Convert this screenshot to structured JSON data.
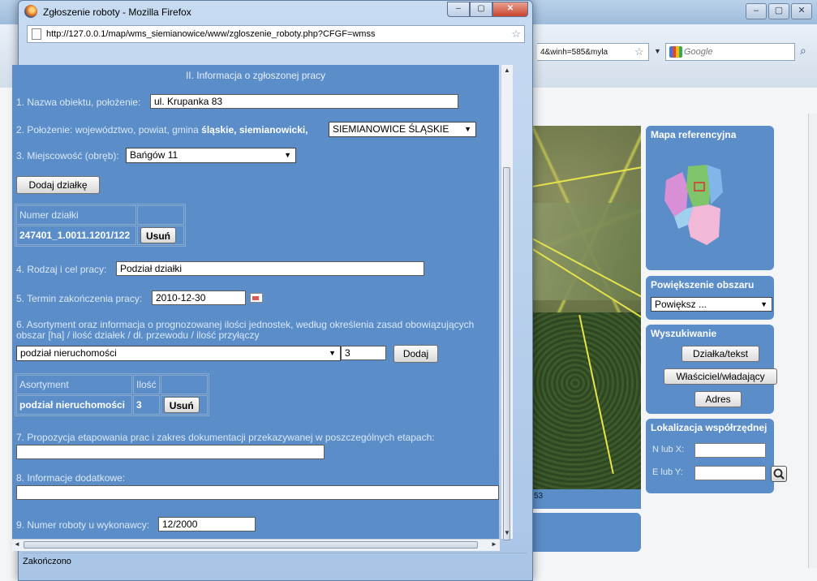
{
  "background": {
    "url_tail": "4&winh=585&myla",
    "search_placeholder": "Google",
    "map_scale_text": "53",
    "window_buttons": [
      "–",
      "▢",
      "✕"
    ],
    "panels": {
      "reference_map": {
        "title": "Mapa referencyjna"
      },
      "zoom": {
        "title": "Powiększenie obszaru",
        "select_value": "Powiększ ..."
      },
      "search": {
        "title": "Wyszukiwanie",
        "buttons": [
          "Działka/tekst",
          "Właściciel/władający",
          "Adres"
        ]
      },
      "coords": {
        "title": "Lokalizacja współrzędnej",
        "label_x": "N lub X:",
        "label_y": "E lub Y:"
      }
    }
  },
  "popup": {
    "title": "Zgłoszenie roboty - Mozilla Firefox",
    "url": "http://127.0.0.1/map/wms_siemianowice/www/zgloszenie_roboty.php?CFGF=wmss",
    "status": "Zakończono",
    "form": {
      "section_header": "II. Informacja o zgłoszonej pracy",
      "f1_label": "1. Nazwa obiektu, położenie:",
      "f1_value": "ul. Krupanka 83",
      "f2_label_prefix": "2. Położenie: województwo, powiat, gmina",
      "f2_label_bold": "śląskie, siemianowicki,",
      "f2_select": "SIEMIANOWICE ŚLĄSKIE",
      "f3_label": "3. Miejscowość (obręb):",
      "f3_select": "Bańgów 11",
      "add_parcel_button": "Dodaj działkę",
      "parcel_table": {
        "header": "Numer działki",
        "row_value": "247401_1.0011.1201/122",
        "remove_button": "Usuń"
      },
      "f4_label": "4. Rodzaj i cel pracy:",
      "f4_value": "Podział działki",
      "f5_label": "5. Termin zakończenia pracy:",
      "f5_value": "2010-12-30",
      "f6_label_line1": "6. Asortyment oraz informacja o prognozowanej ilości jednostek, według określenia zasad obowiązujących",
      "f6_label_line2": "obszar [ha] / ilość działek / dł. przewodu / ilość przyłączy",
      "f6_select": "podział nieruchomości",
      "f6_qty": "3",
      "f6_add_button": "Dodaj",
      "assort_table": {
        "col1": "Asortyment",
        "col2": "Ilość",
        "row_name": "podział nieruchomości",
        "row_qty": "3",
        "remove_button": "Usuń"
      },
      "f7_label": "7. Propozycja etapowania prac i zakres dokumentacji przekazywanej w poszczególnych etapach:",
      "f7_value": "",
      "f8_label": "8. Informacje dodatkowe:",
      "f8_value": "",
      "f9_label": "9. Numer roboty u wykonawcy:",
      "f9_value": "12/2000"
    }
  }
}
